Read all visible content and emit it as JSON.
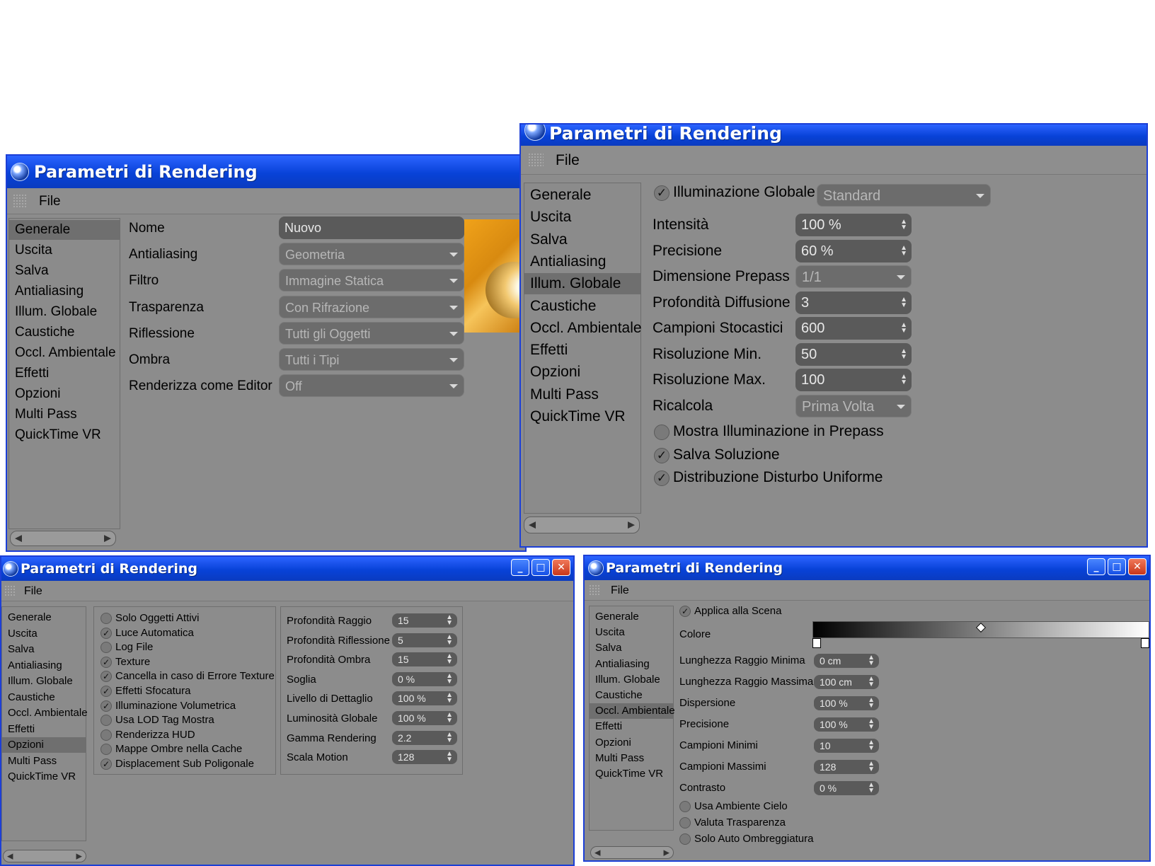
{
  "window_title": "Parametri di Rendering",
  "menu_file": "File",
  "sidebar": [
    "Generale",
    "Uscita",
    "Salva",
    "Antialiasing",
    "Illum. Globale",
    "Caustiche",
    "Occl. Ambientale",
    "Effetti",
    "Opzioni",
    "Multi Pass",
    "QuickTime VR"
  ],
  "w1": {
    "active": "Generale",
    "rows": [
      {
        "label": "Nome",
        "value": "Nuovo",
        "kind": "text"
      },
      {
        "label": "Antialiasing",
        "value": "Geometria",
        "kind": "drop"
      },
      {
        "label": "Filtro",
        "value": "Immagine Statica",
        "kind": "drop"
      },
      {
        "label": "Trasparenza",
        "value": "Con Rifrazione",
        "kind": "drop"
      },
      {
        "label": "Riflessione",
        "value": "Tutti gli Oggetti",
        "kind": "drop"
      },
      {
        "label": "Ombra",
        "value": "Tutti i Tipi",
        "kind": "drop"
      },
      {
        "label": "Renderizza come Editor",
        "value": "Off",
        "kind": "drop"
      }
    ]
  },
  "w2": {
    "active": "Illum. Globale",
    "gi_checkbox": {
      "label": "Illuminazione Globale",
      "checked": true
    },
    "gi_mode": "Standard",
    "rows": [
      {
        "label": "Intensità",
        "value": "100 %",
        "kind": "spin"
      },
      {
        "label": "Precisione",
        "value": "60 %",
        "kind": "spin"
      },
      {
        "label": "Dimensione Prepass",
        "value": "1/1",
        "kind": "drop"
      },
      {
        "label": "Profondità Diffusione",
        "value": "3",
        "kind": "spin"
      },
      {
        "label": "Campioni Stocastici",
        "value": "600",
        "kind": "spin"
      },
      {
        "label": "Risoluzione Min.",
        "value": "50",
        "kind": "spin"
      },
      {
        "label": "Risoluzione Max.",
        "value": "100",
        "kind": "spin"
      },
      {
        "label": "Ricalcola",
        "value": "Prima Volta",
        "kind": "drop"
      }
    ],
    "checks": [
      {
        "label": "Mostra Illuminazione in Prepass",
        "checked": false
      },
      {
        "label": "Salva Soluzione",
        "checked": true
      },
      {
        "label": "Distribuzione Disturbo Uniforme",
        "checked": true
      }
    ]
  },
  "w3": {
    "active": "Opzioni",
    "checks": [
      {
        "label": "Solo Oggetti Attivi",
        "checked": false
      },
      {
        "label": "Luce Automatica",
        "checked": true
      },
      {
        "label": "Log File",
        "checked": false
      },
      {
        "label": "Texture",
        "checked": true
      },
      {
        "label": "Cancella in caso di Errore Texture",
        "checked": true
      },
      {
        "label": "Effetti Sfocatura",
        "checked": true
      },
      {
        "label": "Illuminazione Volumetrica",
        "checked": true
      },
      {
        "label": "Usa LOD Tag Mostra",
        "checked": false
      },
      {
        "label": "Renderizza HUD",
        "checked": false
      },
      {
        "label": "Mappe Ombre nella Cache",
        "checked": false
      },
      {
        "label": "Displacement Sub Poligonale",
        "checked": true
      }
    ],
    "rows": [
      {
        "label": "Profondità Raggio",
        "value": "15"
      },
      {
        "label": "Profondità Riflessione",
        "value": "5"
      },
      {
        "label": "Profondità Ombra",
        "value": "15"
      },
      {
        "label": "Soglia",
        "value": "0 %"
      },
      {
        "label": "Livello di Dettaglio",
        "value": "100 %"
      },
      {
        "label": "Luminosità Globale",
        "value": "100 %"
      },
      {
        "label": "Gamma Rendering",
        "value": "2.2"
      },
      {
        "label": "Scala Motion",
        "value": "128"
      }
    ]
  },
  "w4": {
    "active": "Occl. Ambientale",
    "apply_check": {
      "label": "Applica alla Scena",
      "checked": true
    },
    "color_label": "Colore",
    "rows": [
      {
        "label": "Lunghezza Raggio Minima",
        "value": "0 cm"
      },
      {
        "label": "Lunghezza Raggio Massima",
        "value": "100 cm"
      },
      {
        "label": "Dispersione",
        "value": "100 %"
      },
      {
        "label": "Precisione",
        "value": "100 %"
      },
      {
        "label": "Campioni Minimi",
        "value": "10"
      },
      {
        "label": "Campioni Massimi",
        "value": "128"
      },
      {
        "label": "Contrasto",
        "value": "0 %"
      }
    ],
    "checks": [
      {
        "label": "Usa Ambiente Cielo",
        "checked": false
      },
      {
        "label": "Valuta Trasparenza",
        "checked": false
      },
      {
        "label": "Solo Auto Ombreggiatura",
        "checked": false
      }
    ]
  },
  "titlebar_buttons": {
    "minimize": "_",
    "maximize": "□",
    "close": "✕"
  }
}
